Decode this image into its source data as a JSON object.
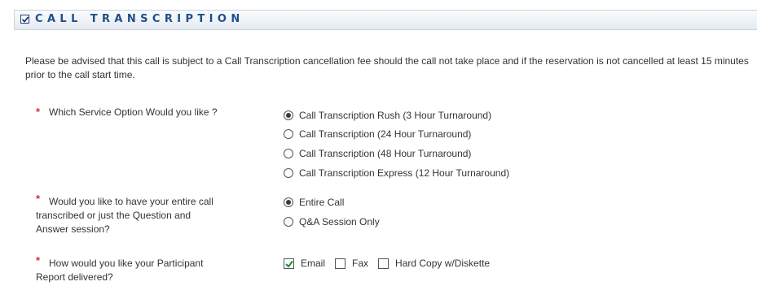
{
  "section": {
    "title": "CALL TRANSCRIPTION",
    "checked": true
  },
  "notice": "Please be advised that this call is subject to a Call Transcription cancellation fee should the call not take place and if the reservation is not cancelled at least 15 minutes prior to the call start time.",
  "required_marker": "*",
  "questions": {
    "service": {
      "label": "Which Service Option Would you like ?",
      "options": [
        {
          "label": "Call Transcription Rush (3 Hour Turnaround)",
          "selected": true
        },
        {
          "label": "Call Transcription (24 Hour Turnaround)",
          "selected": false
        },
        {
          "label": "Call Transcription (48 Hour Turnaround)",
          "selected": false
        },
        {
          "label": "Call Transcription Express (12 Hour Turnaround)",
          "selected": false
        }
      ]
    },
    "scope": {
      "label_lines": [
        "Would you like to have your entire call",
        "transcribed or just the Question and",
        "Answer session?"
      ],
      "options": [
        {
          "label": "Entire Call",
          "selected": true
        },
        {
          "label": "Q&A Session Only",
          "selected": false
        }
      ]
    },
    "delivery": {
      "label_lines": [
        "How would you like your Participant",
        "Report delivered?"
      ],
      "options": [
        {
          "label": "Email",
          "checked": true
        },
        {
          "label": "Fax",
          "checked": false
        },
        {
          "label": "Hard Copy w/Diskette",
          "checked": false
        }
      ]
    }
  },
  "colors": {
    "header_text": "#1f4e8c",
    "required": "#d2322d"
  }
}
